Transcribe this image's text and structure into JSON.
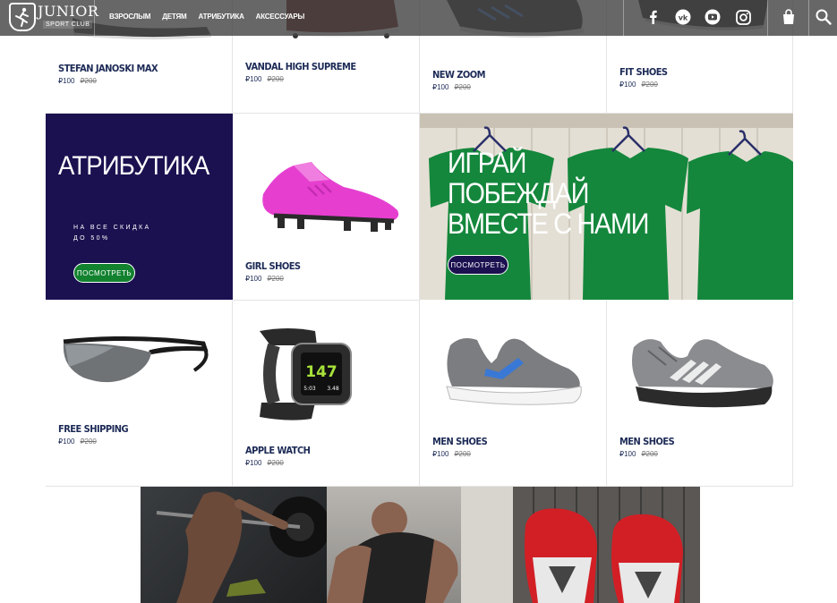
{
  "header": {
    "logo": {
      "brand": "JUNIOR",
      "sub": "SPORT CLUB"
    },
    "nav": [
      "ВЗРОСЛЫМ",
      "ДЕТЯМ",
      "АТРИБУТИКА",
      "АКСЕССУАРЫ"
    ],
    "social_icons": [
      "facebook-icon",
      "vk-icon",
      "youtube-icon",
      "instagram-icon"
    ],
    "icons": [
      "shopping-bag-icon",
      "search-icon"
    ]
  },
  "products_top": [
    {
      "name": "STEFAN JANOSKI MAX",
      "price": "₽100",
      "old_price": "₽200"
    },
    {
      "name": "VANDAL HIGH SUPREME",
      "price": "₽100",
      "old_price": "₽200"
    },
    {
      "name": "NEW ZOOM",
      "price": "₽100",
      "old_price": "₽200"
    },
    {
      "name": "FIT SHOES",
      "price": "₽100",
      "old_price": "₽200"
    }
  ],
  "promo_attributes": {
    "title": "АТРИБУТИКА",
    "line1": "НА ВСЕ СКИДКА",
    "line2": "ДО 50%",
    "button": "ПОСМОТРЕТЬ"
  },
  "girl_shoes": {
    "name": "GIRL SHOES",
    "price": "₽100",
    "old_price": "₽200"
  },
  "promo_play": {
    "line1": "ИГРАЙ",
    "line2": "ПОБЕЖДАЙ",
    "line3": "ВМЕСТЕ С НАМИ",
    "button": "ПОСМОТРЕТЬ"
  },
  "products_bottom": [
    {
      "name": "FREE SHIPPING",
      "price": "₽100",
      "old_price": "₽200"
    },
    {
      "name": "APPLE WATCH",
      "price": "₽100",
      "old_price": "₽200"
    },
    {
      "name": "MEN SHOES",
      "price": "₽100",
      "old_price": "₽200"
    },
    {
      "name": "MEN SHOES",
      "price": "₽100",
      "old_price": "₽200"
    }
  ],
  "watch_display": {
    "big": "147",
    "left": "5:03",
    "right": "3.48"
  },
  "colors": {
    "header": "#464646",
    "navy": "#1b1150",
    "green": "#12822f",
    "product_text": "#1c2a56"
  }
}
